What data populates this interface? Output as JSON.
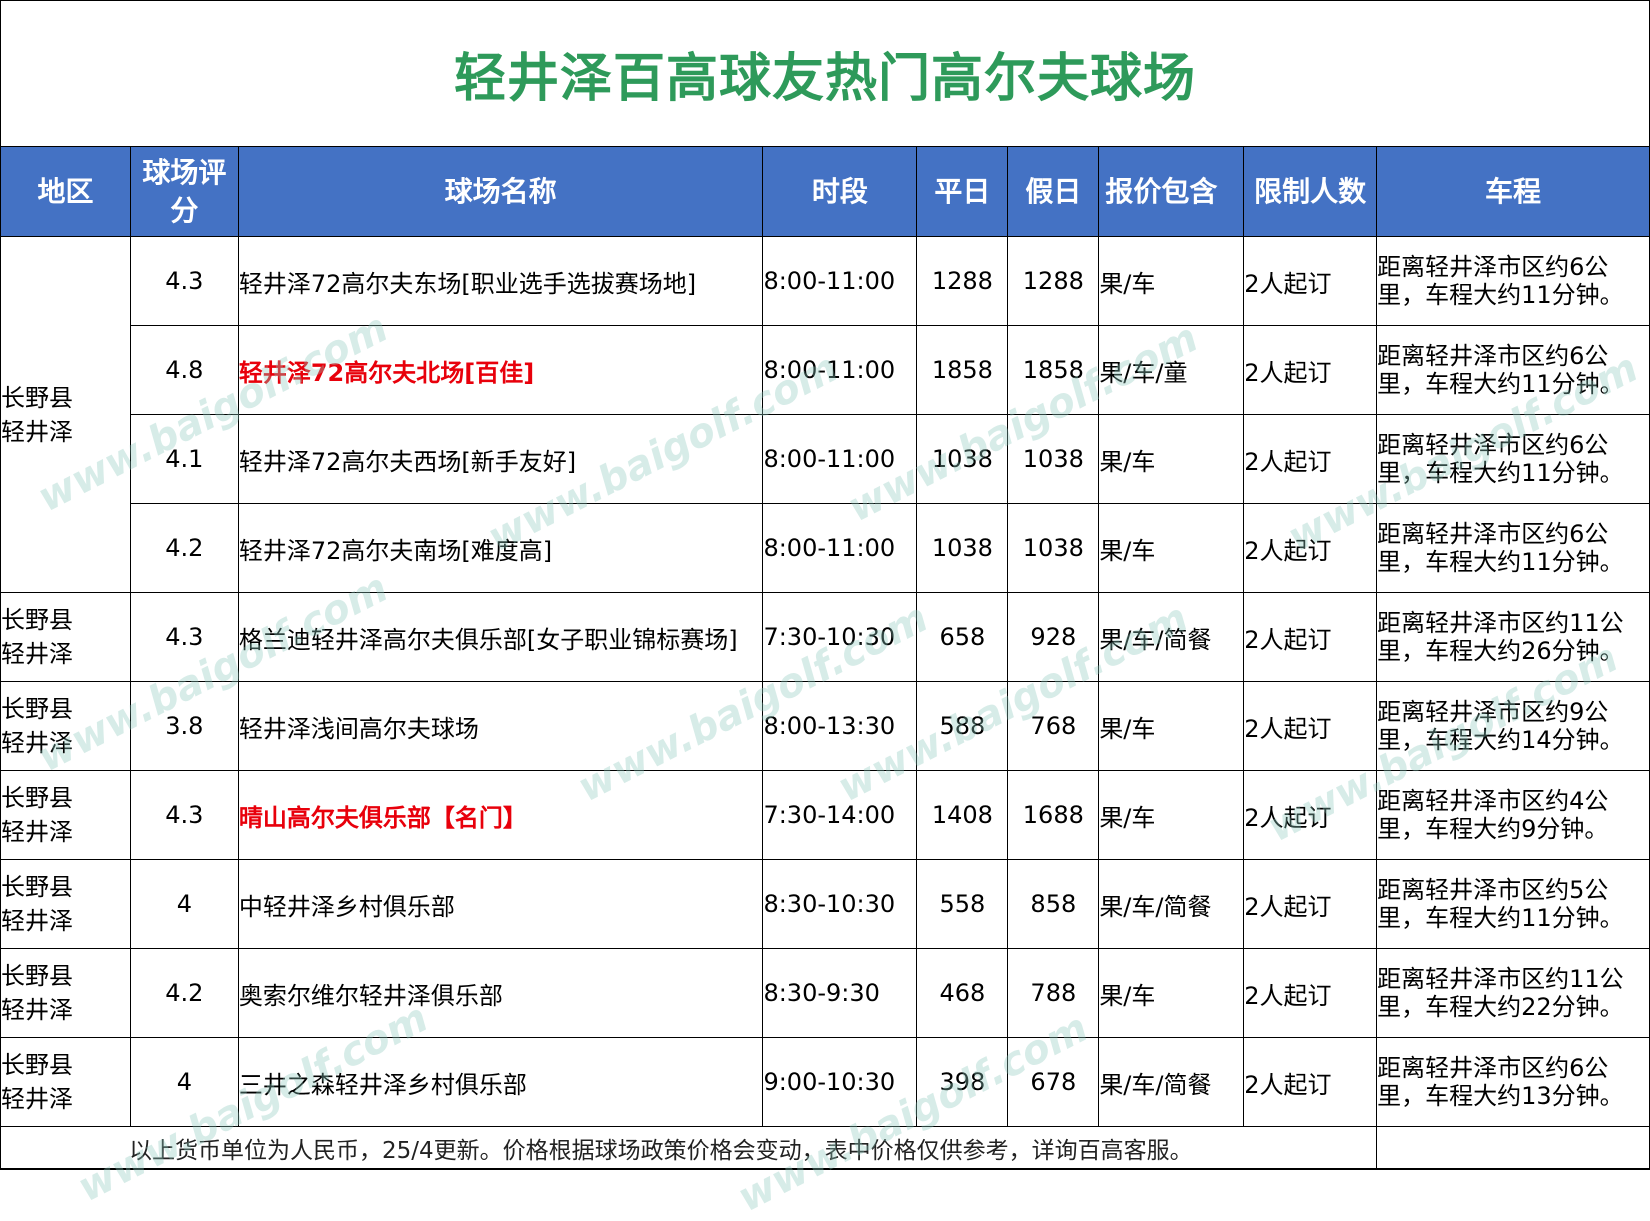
{
  "title": "轻井泽百高球友热门高尔夫球场",
  "headers": {
    "region": "地区",
    "rating": "球场评分",
    "name": "球场名称",
    "time": "时段",
    "weekday": "平日",
    "holiday": "假日",
    "includes": "报价包含",
    "limit": "限制人数",
    "distance": "车程"
  },
  "region_merged": "长野县\n轻井泽",
  "rows": [
    {
      "region": "长野县\n轻井泽",
      "rating": "4.3",
      "name": "轻井泽72高尔夫东场[职业选手选拔赛场地]",
      "time": "8:00-11:00",
      "weekday": "1288",
      "holiday": "1288",
      "includes": "果/车",
      "limit": "2人起订",
      "distance": "距离轻井泽市区约6公里，车程大约11分钟。"
    },
    {
      "region": "长野县\n轻井泽",
      "rating": "4.8",
      "name": "轻井泽72高尔夫北场[百佳]",
      "time": "8:00-11:00",
      "weekday": "1858",
      "holiday": "1858",
      "includes": "果/车/童",
      "limit": "2人起订",
      "distance": "距离轻井泽市区约6公里，车程大约11分钟。",
      "highlight": true
    },
    {
      "region": "长野县\n轻井泽",
      "rating": "4.1",
      "name": "轻井泽72高尔夫西场[新手友好]",
      "time": "8:00-11:00",
      "weekday": "1038",
      "holiday": "1038",
      "includes": "果/车",
      "limit": "2人起订",
      "distance": "距离轻井泽市区约6公里，车程大约11分钟。"
    },
    {
      "region": "长野县\n轻井泽",
      "rating": "4.2",
      "name": "轻井泽72高尔夫南场[难度高]",
      "time": "8:00-11:00",
      "weekday": "1038",
      "holiday": "1038",
      "includes": "果/车",
      "limit": "2人起订",
      "distance": "距离轻井泽市区约6公里，车程大约11分钟。"
    },
    {
      "region": "长野县\n轻井泽",
      "rating": "4.3",
      "name": "格兰迪轻井泽高尔夫俱乐部[女子职业锦标赛场]",
      "time": "7:30-10:30",
      "weekday": "658",
      "holiday": "928",
      "includes": "果/车/简餐",
      "limit": "2人起订",
      "distance": "距离轻井泽市区约11公里，车程大约26分钟。"
    },
    {
      "region": "长野县\n轻井泽",
      "rating": "3.8",
      "name": "轻井泽浅间高尔夫球场",
      "time": "8:00-13:30",
      "weekday": "588",
      "holiday": "768",
      "includes": "果/车",
      "limit": "2人起订",
      "distance": "距离轻井泽市区约9公里，车程大约14分钟。"
    },
    {
      "region": "长野县\n轻井泽",
      "rating": "4.3",
      "name": "晴山高尔夫俱乐部【名门】",
      "time": "7:30-14:00",
      "weekday": "1408",
      "holiday": "1688",
      "includes": "果/车",
      "limit": "2人起订",
      "distance": "距离轻井泽市区约4公里，车程大约9分钟。",
      "highlight": true
    },
    {
      "region": "长野县\n轻井泽",
      "rating": "4",
      "name": "中轻井泽乡村俱乐部",
      "time": "8:30-10:30",
      "weekday": "558",
      "holiday": "858",
      "includes": "果/车/简餐",
      "limit": "2人起订",
      "distance": "距离轻井泽市区约5公里，车程大约11分钟。"
    },
    {
      "region": "长野县\n轻井泽",
      "rating": "4.2",
      "name": "奥索尔维尔轻井泽俱乐部",
      "time": "8:30-9:30",
      "weekday": "468",
      "holiday": "788",
      "includes": "果/车",
      "limit": "2人起订",
      "distance": "距离轻井泽市区约11公里，车程大约22分钟。"
    },
    {
      "region": "长野县\n轻井泽",
      "rating": "4",
      "name": "三井之森轻井泽乡村俱乐部",
      "time": "9:00-10:30",
      "weekday": "398",
      "holiday": "678",
      "includes": "果/车/简餐",
      "limit": "2人起订",
      "distance": "距离轻井泽市区约6公里，车程大约13分钟。"
    }
  ],
  "footer": "以上货币单位为人民币，25/4更新。价格根据球场政策价格会变动，表中价格仅供参考，详询百高客服。",
  "watermark": "www.baigolf.com",
  "colors": {
    "header_bg": "#4472c4",
    "title": "#2e9a5a",
    "highlight": "#e8000b"
  }
}
